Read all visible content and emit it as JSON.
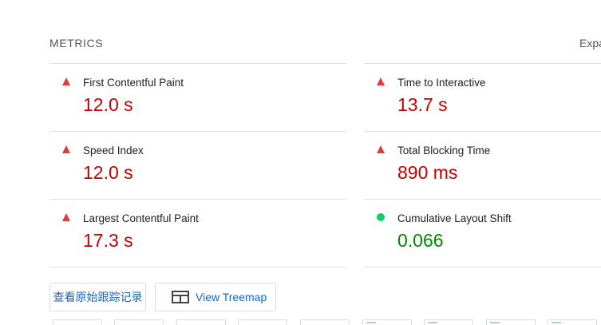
{
  "header": {
    "title": "METRICS",
    "expand_label": "Expand view"
  },
  "metrics": [
    {
      "label": "First Contentful Paint",
      "value": "12.0 s",
      "status": "fail"
    },
    {
      "label": "Time to Interactive",
      "value": "13.7 s",
      "status": "fail"
    },
    {
      "label": "Speed Index",
      "value": "12.0 s",
      "status": "fail"
    },
    {
      "label": "Total Blocking Time",
      "value": "890 ms",
      "status": "fail"
    },
    {
      "label": "Largest Contentful Paint",
      "value": "17.3 s",
      "status": "fail"
    },
    {
      "label": "Cumulative Layout Shift",
      "value": "0.066",
      "status": "pass"
    }
  ],
  "buttons": {
    "trace_label": "查看原始跟踪记录",
    "treemap_label": "View Treemap"
  },
  "icons": {
    "fail": "red-triangle-icon",
    "pass": "green-circle-icon",
    "treemap": "treemap-icon"
  },
  "colors": {
    "fail": "#c50000",
    "fail_icon": "#e53935",
    "pass": "#008800",
    "pass_icon": "#0cce6b",
    "link": "#1565c0"
  },
  "filmstrip": {
    "frames": 9,
    "frames_with_content": [
      5,
      6,
      7,
      8
    ]
  }
}
